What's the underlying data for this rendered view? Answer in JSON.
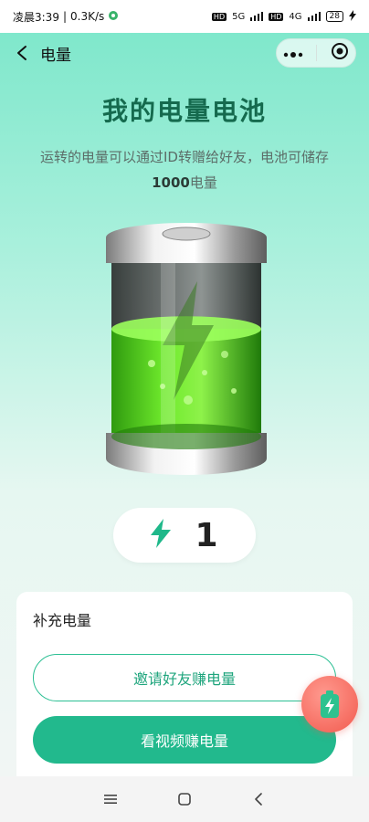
{
  "status_bar": {
    "time": "凌晨3:39",
    "net_speed": "0.3K/s",
    "hd1": "HD",
    "gen1": "5G",
    "hd2": "HD",
    "gen2": "4G",
    "battery": "28"
  },
  "title_bar": {
    "title": "电量"
  },
  "hero": {
    "title": "我的电量电池",
    "desc_part1": "运转的电量可以通过ID转赠给好友，电池可储存",
    "desc_strong": "1000",
    "desc_part2": "电量"
  },
  "energy": {
    "count": "1",
    "fill_level": 0.62
  },
  "card": {
    "title": "补充电量",
    "invite_label": "邀请好友赚电量",
    "video_label": "看视频赚电量"
  },
  "colors": {
    "accent": "#22b98d",
    "title_green": "#156a4e",
    "badge_red": "#f25a4e"
  },
  "icons": {
    "back": "back-arrow-icon",
    "more": "more-dots-icon",
    "target": "target-icon",
    "bolt": "lightning-bolt-icon",
    "float": "battery-gift-icon"
  }
}
